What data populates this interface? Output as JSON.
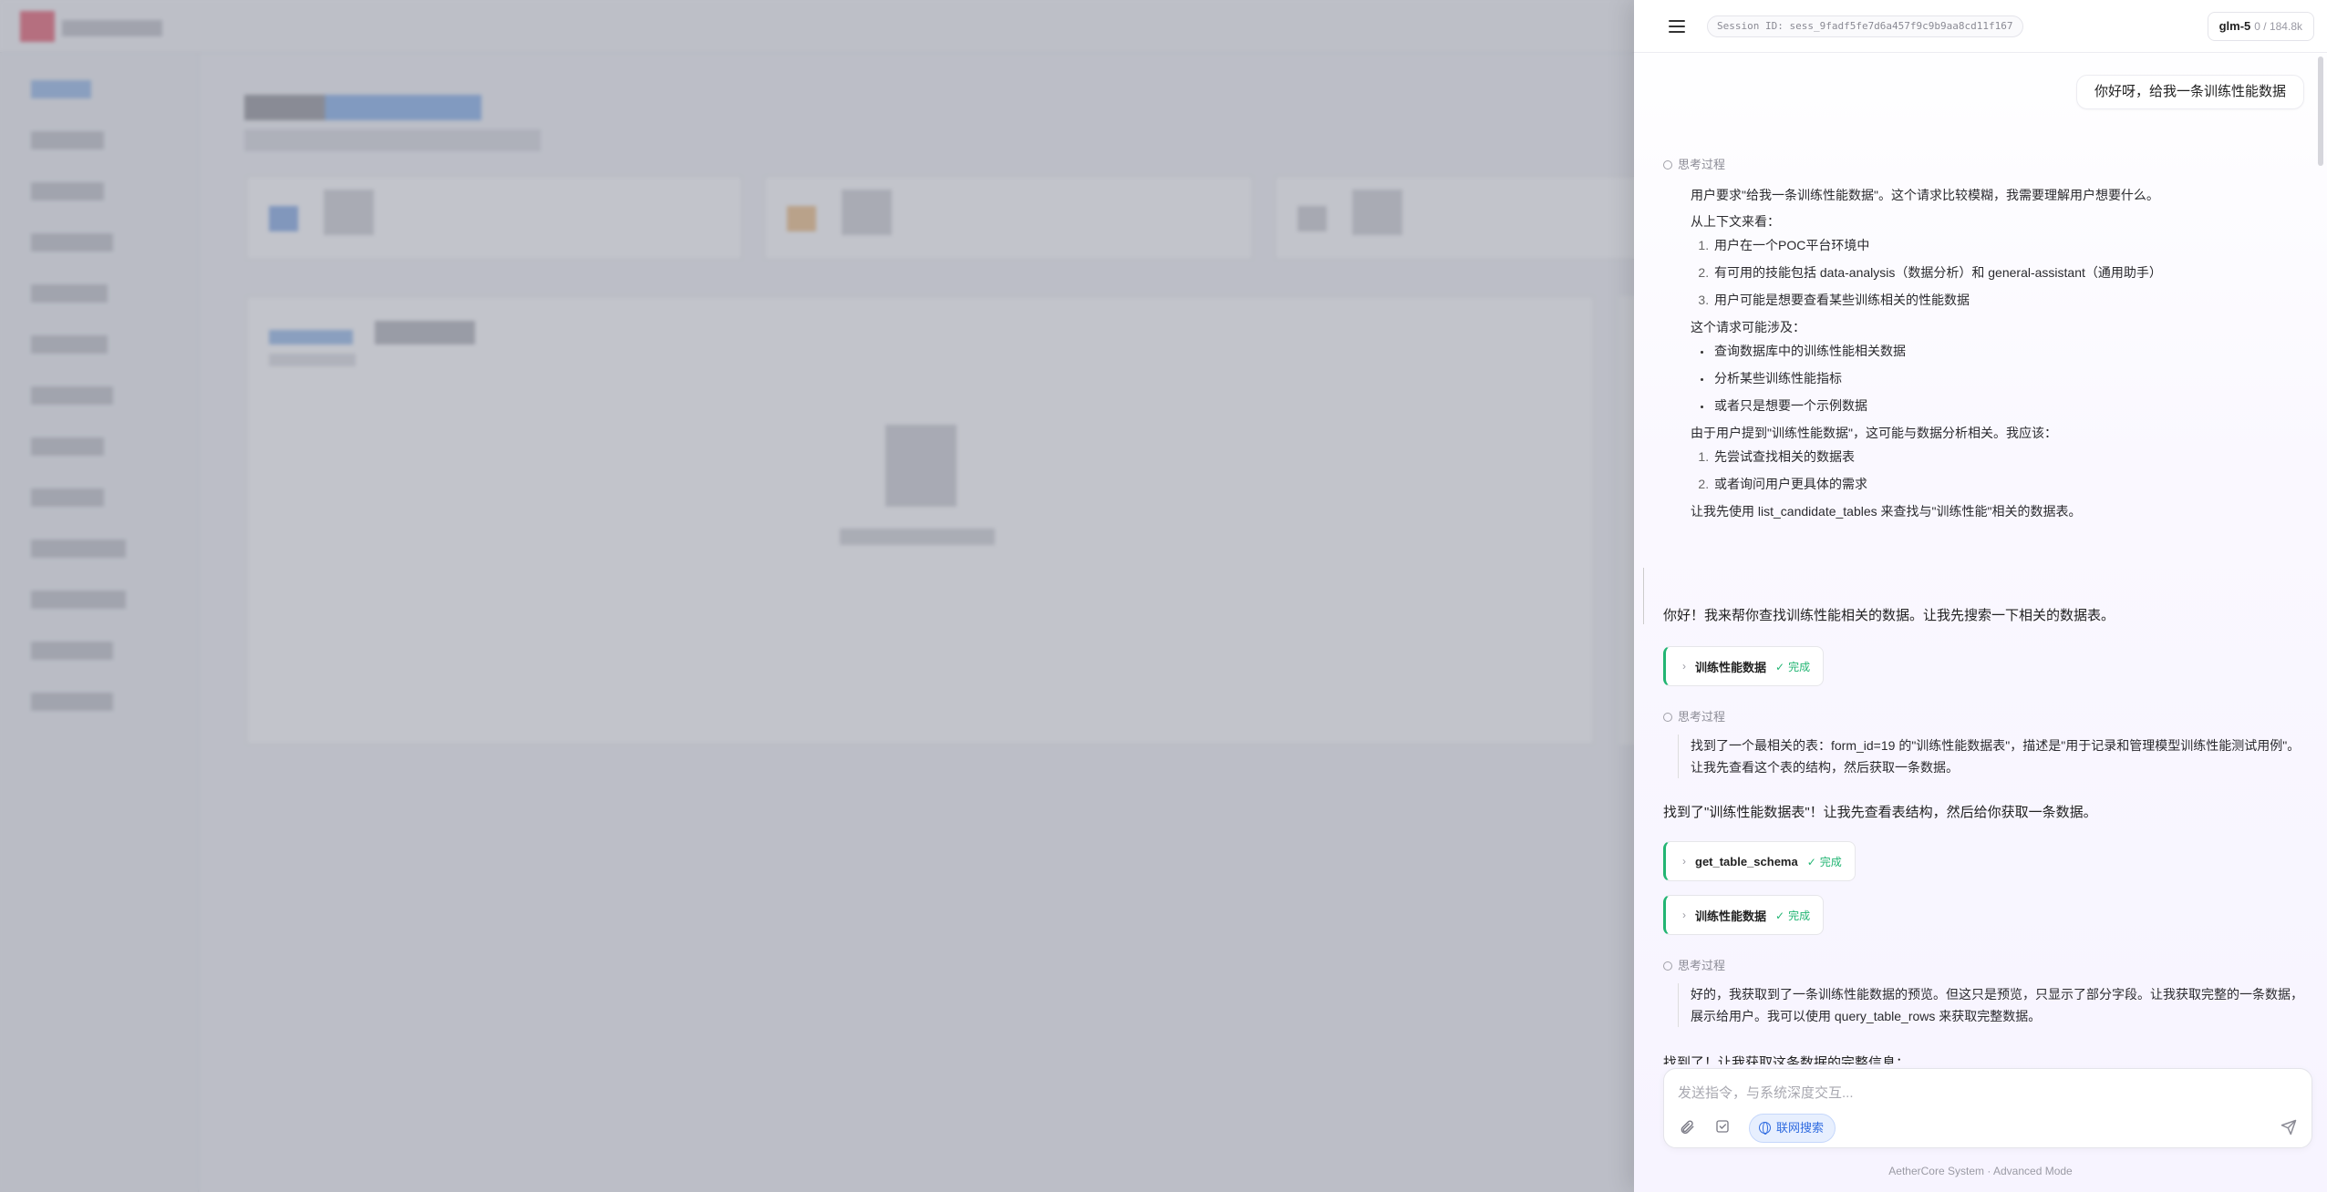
{
  "header": {
    "session_label": "Session ID: sess_9fadf5fe7d6a457f9c9b9aa8cd11f167",
    "model_name": "glm-5",
    "token_usage": "0 / 184.8k"
  },
  "chat": {
    "user_message": "你好呀，给我一条训练性能数据",
    "think_label": "思考过程",
    "think1": {
      "p1": "用户要求\"给我一条训练性能数据\"。这个请求比较模糊，我需要理解用户想要什么。",
      "p2": "从上下文来看：",
      "ol1": [
        "用户在一个POC平台环境中",
        "有可用的技能包括 data-analysis（数据分析）和 general-assistant（通用助手）",
        "用户可能是想要查看某些训练相关的性能数据"
      ],
      "p3": "这个请求可能涉及：",
      "ul1": [
        "查询数据库中的训练性能相关数据",
        "分析某些训练性能指标",
        "或者只是想要一个示例数据"
      ],
      "p4": "由于用户提到\"训练性能数据\"，这可能与数据分析相关。我应该：",
      "ol2": [
        "先尝试查找相关的数据表",
        "或者询问用户更具体的需求"
      ],
      "p5": "让我先使用 list_candidate_tables 来查找与\"训练性能\"相关的数据表。"
    },
    "answer1": "你好！我来帮你查找训练性能相关的数据。让我先搜索一下相关的数据表。",
    "tool1": {
      "name": "训练性能数据",
      "status": "完成"
    },
    "think2": {
      "p1": "找到了一个最相关的表：form_id=19 的\"训练性能数据表\"，描述是\"用于记录和管理模型训练性能测试用例\"。让我先查看这个表的结构，然后获取一条数据。"
    },
    "answer2": "找到了\"训练性能数据表\"！让我先查看表结构，然后给你获取一条数据。",
    "tool2": {
      "name": "get_table_schema",
      "status": "完成"
    },
    "tool3": {
      "name": "训练性能数据",
      "status": "完成"
    },
    "think3": {
      "p1": "好的，我获取到了一条训练性能数据的预览。但这只是预览，只显示了部分字段。让我获取完整的一条数据，展示给用户。我可以使用 query_table_rows 来获取完整数据。"
    },
    "answer3_partial": "找到了！让我获取这条数据的完整信息："
  },
  "composer": {
    "placeholder": "发送指令，与系统深度交互...",
    "web_search_label": "联网搜索"
  },
  "footer": "AetherCore System · Advanced Mode",
  "colors": {
    "accent": "#2f6be0",
    "success": "#22b573"
  }
}
